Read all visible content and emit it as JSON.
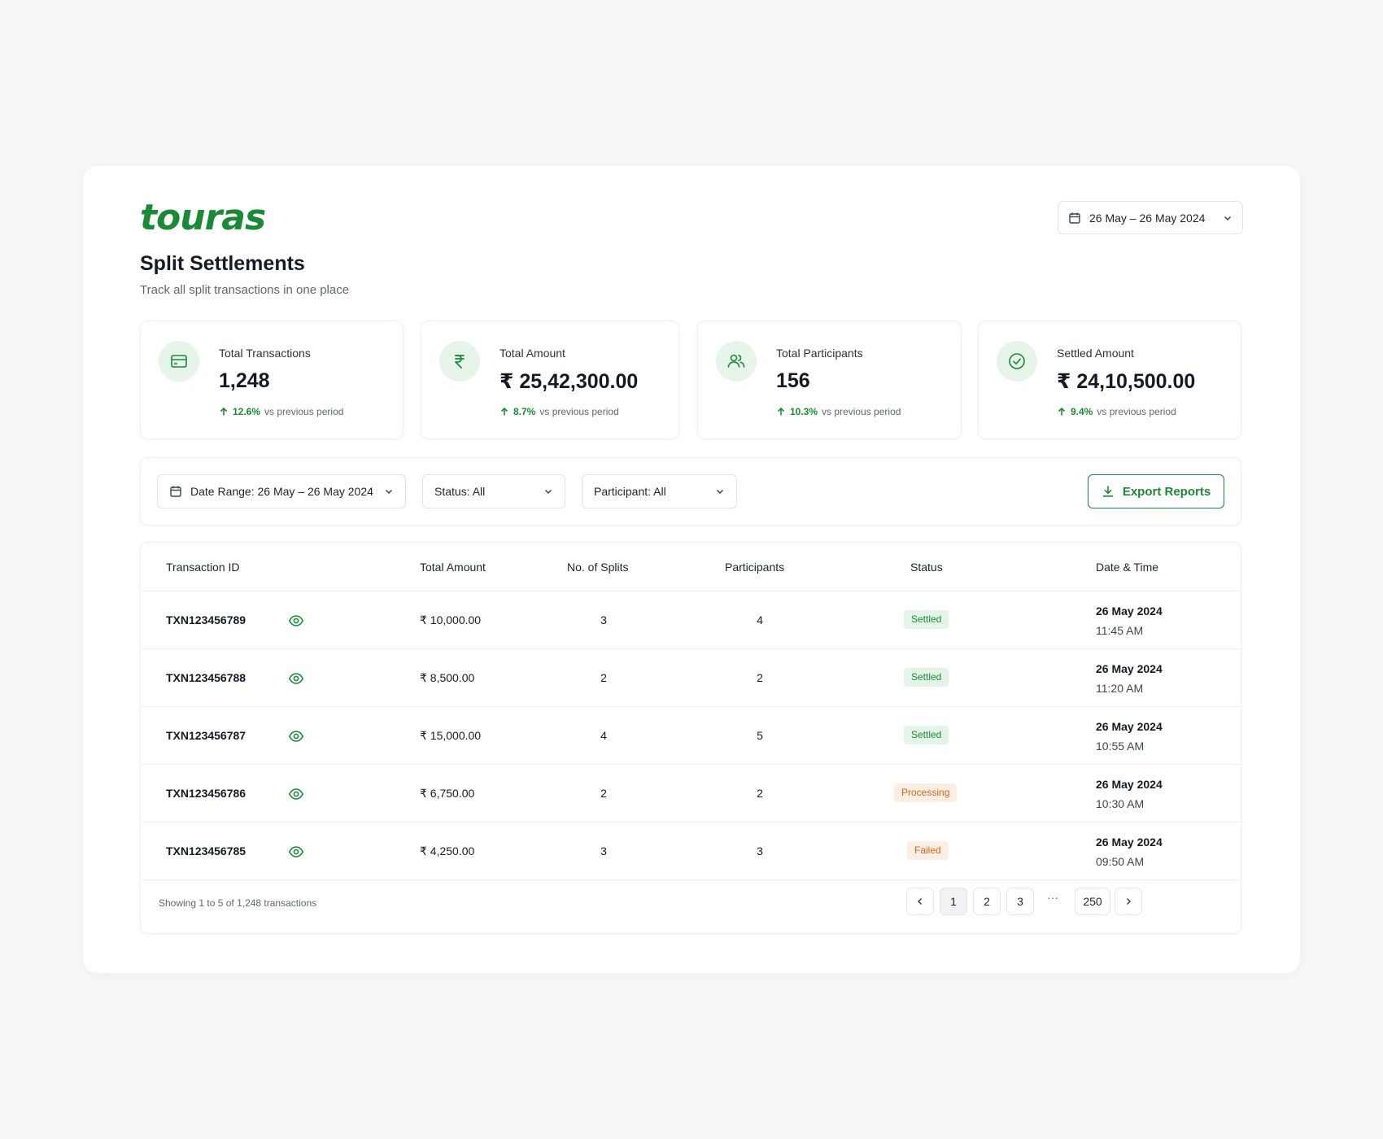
{
  "brand": {
    "logo_text": "touras",
    "color": "#1a8a36"
  },
  "header": {
    "date_range": "26 May – 26 May 2024"
  },
  "page": {
    "title": "Split Settlements",
    "subtitle": "Track all split transactions in one place"
  },
  "stats": [
    {
      "icon": "card-icon",
      "label": "Total Transactions",
      "value": "1,248",
      "change": "12.6%",
      "change_note": "vs previous period"
    },
    {
      "icon": "rupee-icon",
      "label": "Total Amount",
      "value": "₹ 25,42,300.00",
      "change": "8.7%",
      "change_note": "vs previous period"
    },
    {
      "icon": "users-icon",
      "label": "Total Participants",
      "value": "156",
      "change": "10.3%",
      "change_note": "vs previous period"
    },
    {
      "icon": "check-circle-icon",
      "label": "Settled Amount",
      "value": "₹ 24,10,500.00",
      "change": "9.4%",
      "change_note": "vs previous period"
    }
  ],
  "filters": {
    "date_range": "Date Range: 26 May – 26 May 2024",
    "status": "Status: All",
    "participant": "Participant: All",
    "export_label": "Export Reports"
  },
  "table": {
    "columns": [
      "Transaction ID",
      "Total Amount",
      "No. of Splits",
      "Participants",
      "Status",
      "Date & Time"
    ],
    "rows": [
      {
        "id": "TXN123456789",
        "amount": "₹ 10,000.00",
        "splits": "3",
        "participants": "4",
        "status": "Settled",
        "date": "26 May 2024",
        "time": "11:45 AM"
      },
      {
        "id": "TXN123456788",
        "amount": "₹ 8,500.00",
        "splits": "2",
        "participants": "2",
        "status": "Settled",
        "date": "26 May 2024",
        "time": "11:20 AM"
      },
      {
        "id": "TXN123456787",
        "amount": "₹ 15,000.00",
        "splits": "4",
        "participants": "5",
        "status": "Settled",
        "date": "26 May 2024",
        "time": "10:55 AM"
      },
      {
        "id": "TXN123456786",
        "amount": "₹ 6,750.00",
        "splits": "2",
        "participants": "2",
        "status": "Processing",
        "date": "26 May 2024",
        "time": "10:30 AM"
      },
      {
        "id": "TXN123456785",
        "amount": "₹ 4,250.00",
        "splits": "3",
        "participants": "3",
        "status": "Failed",
        "date": "26 May 2024",
        "time": "09:50 AM"
      }
    ]
  },
  "status_colors": {
    "Settled": {
      "bg": "#e5f4e9",
      "fg": "#1a8a36"
    },
    "Processing": {
      "bg": "#fdeee3",
      "fg": "#d9661f"
    },
    "Failed": {
      "bg": "#fdeee3",
      "fg": "#d9661f"
    }
  },
  "pagination": {
    "summary": "Showing 1 to 5 of 1,248 transactions",
    "pages": [
      "1",
      "2",
      "3"
    ],
    "ellipsis": "···",
    "last_page": "250",
    "current": "1"
  }
}
